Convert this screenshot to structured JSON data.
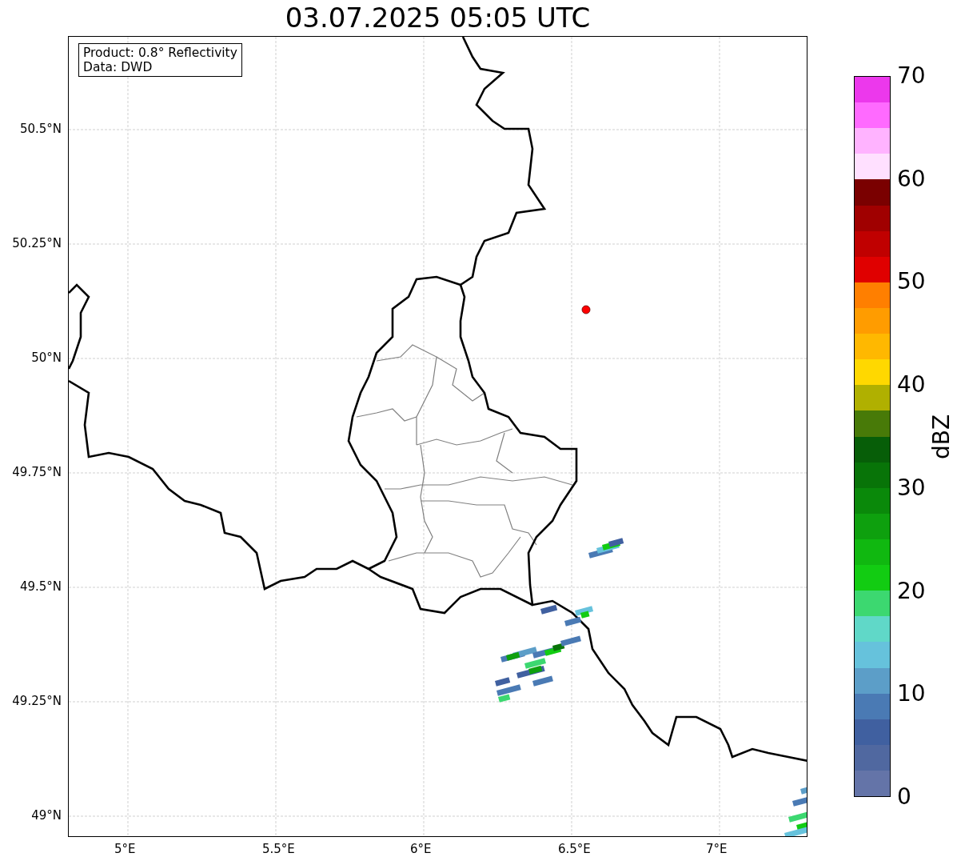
{
  "title": "03.07.2025 05:05 UTC",
  "info_box": [
    "Product: 0.8° Reflectivity",
    "Data: DWD"
  ],
  "y_ticks": [
    "50.5°N",
    "50.25°N",
    "50°N",
    "49.75°N",
    "49.5°N",
    "49.25°N",
    "49°N"
  ],
  "x_ticks": [
    "5°E",
    "5.5°E",
    "6°E",
    "6.5°E",
    "7°E"
  ],
  "colorbar": {
    "label": "dBZ",
    "ticks": [
      "70",
      "60",
      "50",
      "40",
      "30",
      "20",
      "10",
      "0"
    ],
    "bands": [
      {
        "color": "#ec38ec"
      },
      {
        "color": "#ff6aff"
      },
      {
        "color": "#ffb3ff"
      },
      {
        "color": "#ffe0ff"
      },
      {
        "color": "#7a0000"
      },
      {
        "color": "#a00000"
      },
      {
        "color": "#c00000"
      },
      {
        "color": "#e00000"
      },
      {
        "color": "#ff7f00"
      },
      {
        "color": "#ff9c00"
      },
      {
        "color": "#ffb800"
      },
      {
        "color": "#ffd800"
      },
      {
        "color": "#b0b000"
      },
      {
        "color": "#487a08"
      },
      {
        "color": "#075e08"
      },
      {
        "color": "#087408"
      },
      {
        "color": "#0a890a"
      },
      {
        "color": "#0ea00e"
      },
      {
        "color": "#10b810"
      },
      {
        "color": "#12cc12"
      },
      {
        "color": "#3cd870"
      },
      {
        "color": "#60d8c8"
      },
      {
        "color": "#66c2dc"
      },
      {
        "color": "#5c9ec8"
      },
      {
        "color": "#4a7ab4"
      },
      {
        "color": "#4060a0"
      },
      {
        "color": "#5068a0"
      },
      {
        "color": "#6474a8"
      }
    ]
  }
}
